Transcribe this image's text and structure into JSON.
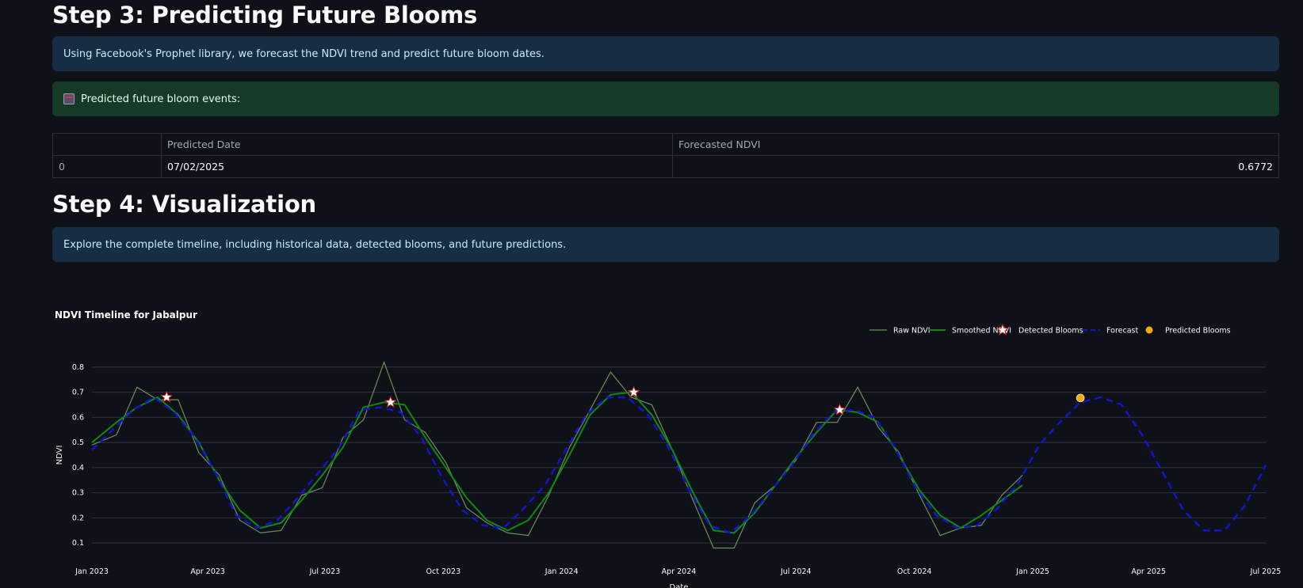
{
  "step3": {
    "heading": "Step 3: Predicting Future Blooms",
    "info": "Using Facebook's Prophet library, we forecast the NDVI trend and predict future bloom dates.",
    "success_icon": "calendar-icon",
    "success": "Predicted future bloom events:",
    "table": {
      "columns": [
        "",
        "Predicted Date",
        "Forecasted NDVI"
      ],
      "rows": [
        [
          "0",
          "07/02/2025",
          "0.6772"
        ]
      ]
    }
  },
  "step4": {
    "heading": "Step 4: Visualization",
    "info": "Explore the complete timeline, including historical data, detected blooms, and future predictions."
  },
  "colors": {
    "raw": "#6d8f5a",
    "smoothed": "#0f8a0f",
    "forecast": "#1414d4",
    "bloom_star": "#ffffff",
    "bloom_star_stroke": "#d42020",
    "predicted": "#f0ad10"
  },
  "chart_data": {
    "type": "line",
    "title": "NDVI Timeline for Jabalpur",
    "xlabel": "Date",
    "ylabel": "NDVI",
    "ylim": [
      0.05,
      0.85
    ],
    "yticks": [
      "0.1",
      "0.2",
      "0.3",
      "0.4",
      "0.5",
      "0.6",
      "0.7",
      "0.8"
    ],
    "xticks": [
      "Jan 2023",
      "Apr 2023",
      "Jul 2023",
      "Oct 2023",
      "Jan 2024",
      "Apr 2024",
      "Jul 2024",
      "Oct 2024",
      "Jan 2025",
      "Apr 2025",
      "Jul 2025"
    ],
    "legend": [
      "Raw NDVI",
      "Smoothed NDVI",
      "Detected Blooms",
      "Forecast",
      "Predicted Blooms"
    ],
    "legend_position": "top-right",
    "grid": true,
    "series": [
      {
        "name": "Raw NDVI",
        "x": [
          "2023-01-01",
          "2023-01-20",
          "2023-02-05",
          "2023-02-21",
          "2023-03-09",
          "2023-03-25",
          "2023-04-10",
          "2023-04-26",
          "2023-05-12",
          "2023-05-28",
          "2023-06-13",
          "2023-06-29",
          "2023-07-15",
          "2023-07-31",
          "2023-08-16",
          "2023-09-01",
          "2023-09-17",
          "2023-10-03",
          "2023-10-19",
          "2023-11-04",
          "2023-11-20",
          "2023-12-06",
          "2023-12-22",
          "2024-01-07",
          "2024-01-23",
          "2024-02-08",
          "2024-02-24",
          "2024-03-11",
          "2024-03-27",
          "2024-04-12",
          "2024-04-28",
          "2024-05-14",
          "2024-05-30",
          "2024-06-15",
          "2024-07-01",
          "2024-07-17",
          "2024-08-02",
          "2024-08-18",
          "2024-09-03",
          "2024-09-19",
          "2024-10-05",
          "2024-10-21",
          "2024-11-06",
          "2024-11-22",
          "2024-12-08",
          "2024-12-24"
        ],
        "y": [
          0.49,
          0.53,
          0.72,
          0.67,
          0.67,
          0.46,
          0.37,
          0.19,
          0.14,
          0.15,
          0.29,
          0.32,
          0.52,
          0.59,
          0.82,
          0.59,
          0.54,
          0.42,
          0.24,
          0.18,
          0.14,
          0.13,
          0.29,
          0.48,
          0.63,
          0.78,
          0.68,
          0.65,
          0.47,
          0.27,
          0.08,
          0.08,
          0.26,
          0.33,
          0.43,
          0.58,
          0.58,
          0.72,
          0.56,
          0.46,
          0.29,
          0.13,
          0.16,
          0.17,
          0.29,
          0.37
        ]
      },
      {
        "name": "Smoothed NDVI",
        "x": [
          "2023-01-01",
          "2023-01-20",
          "2023-02-05",
          "2023-02-21",
          "2023-03-09",
          "2023-03-25",
          "2023-04-10",
          "2023-04-26",
          "2023-05-12",
          "2023-05-28",
          "2023-06-13",
          "2023-06-29",
          "2023-07-15",
          "2023-07-31",
          "2023-08-16",
          "2023-09-01",
          "2023-09-17",
          "2023-10-03",
          "2023-10-19",
          "2023-11-04",
          "2023-11-20",
          "2023-12-06",
          "2023-12-22",
          "2024-01-07",
          "2024-01-23",
          "2024-02-08",
          "2024-02-24",
          "2024-03-11",
          "2024-03-27",
          "2024-04-12",
          "2024-04-28",
          "2024-05-14",
          "2024-05-30",
          "2024-06-15",
          "2024-07-01",
          "2024-07-17",
          "2024-08-02",
          "2024-08-18",
          "2024-09-03",
          "2024-09-19",
          "2024-10-05",
          "2024-10-21",
          "2024-11-06",
          "2024-11-22",
          "2024-12-08",
          "2024-12-24"
        ],
        "y": [
          0.5,
          0.58,
          0.64,
          0.68,
          0.61,
          0.5,
          0.35,
          0.23,
          0.16,
          0.18,
          0.27,
          0.37,
          0.48,
          0.64,
          0.66,
          0.65,
          0.52,
          0.4,
          0.28,
          0.19,
          0.15,
          0.19,
          0.3,
          0.45,
          0.61,
          0.69,
          0.7,
          0.61,
          0.47,
          0.3,
          0.15,
          0.14,
          0.22,
          0.33,
          0.44,
          0.54,
          0.63,
          0.62,
          0.58,
          0.45,
          0.31,
          0.21,
          0.16,
          0.21,
          0.27,
          0.33
        ]
      },
      {
        "name": "Forecast",
        "x": [
          "2023-01-01",
          "2023-01-17",
          "2023-02-02",
          "2023-02-18",
          "2023-03-06",
          "2023-03-22",
          "2023-04-07",
          "2023-04-23",
          "2023-05-09",
          "2023-05-25",
          "2023-06-10",
          "2023-06-26",
          "2023-07-12",
          "2023-07-28",
          "2023-08-13",
          "2023-08-29",
          "2023-09-14",
          "2023-09-30",
          "2023-10-16",
          "2023-11-01",
          "2023-11-17",
          "2023-12-03",
          "2023-12-19",
          "2024-01-04",
          "2024-01-20",
          "2024-02-05",
          "2024-02-21",
          "2024-03-08",
          "2024-03-24",
          "2024-04-09",
          "2024-04-25",
          "2024-05-11",
          "2024-05-27",
          "2024-06-12",
          "2024-06-28",
          "2024-07-14",
          "2024-07-30",
          "2024-08-15",
          "2024-08-31",
          "2024-09-16",
          "2024-10-02",
          "2024-10-18",
          "2024-11-03",
          "2024-11-19",
          "2024-12-05",
          "2024-12-21",
          "2025-01-06",
          "2025-01-22",
          "2025-02-07",
          "2025-02-23",
          "2025-03-11",
          "2025-03-27",
          "2025-04-12",
          "2025-04-28",
          "2025-05-14",
          "2025-05-30",
          "2025-06-15",
          "2025-07-01"
        ],
        "y": [
          0.47,
          0.55,
          0.63,
          0.68,
          0.62,
          0.52,
          0.38,
          0.21,
          0.16,
          0.19,
          0.28,
          0.38,
          0.48,
          0.63,
          0.64,
          0.62,
          0.52,
          0.36,
          0.23,
          0.17,
          0.16,
          0.24,
          0.33,
          0.47,
          0.61,
          0.68,
          0.68,
          0.61,
          0.48,
          0.31,
          0.17,
          0.14,
          0.21,
          0.31,
          0.41,
          0.53,
          0.62,
          0.63,
          0.6,
          0.48,
          0.32,
          0.21,
          0.16,
          0.17,
          0.24,
          0.34,
          0.49,
          0.58,
          0.66,
          0.68,
          0.65,
          0.53,
          0.38,
          0.23,
          0.15,
          0.15,
          0.25,
          0.41
        ]
      }
    ],
    "detected_blooms": [
      {
        "date": "2023-02-28",
        "ndvi": 0.68
      },
      {
        "date": "2023-08-21",
        "ndvi": 0.66
      },
      {
        "date": "2024-02-26",
        "ndvi": 0.7
      },
      {
        "date": "2024-08-04",
        "ndvi": 0.63
      }
    ],
    "predicted_blooms": [
      {
        "date": "2025-02-07",
        "ndvi": 0.6772
      }
    ]
  }
}
